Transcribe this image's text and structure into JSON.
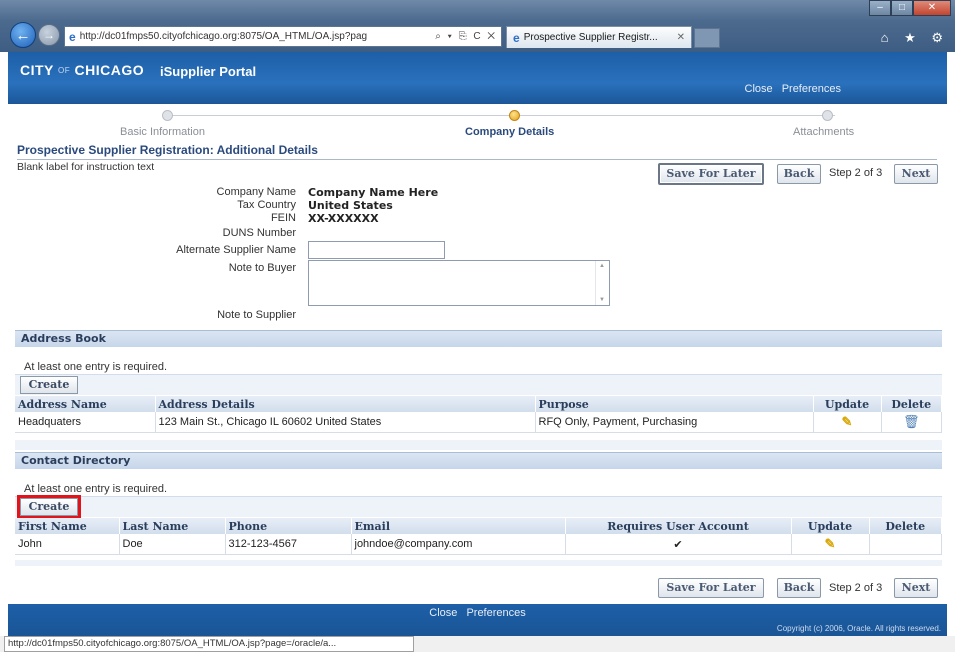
{
  "browser": {
    "url": "http://dc01fmps50.cityofchicago.org:8075/OA_HTML/OA.jsp?pag",
    "url_tools": "⌕ ▾ ⎘ C ✕",
    "tab_title": "Prospective Supplier Registr...",
    "tab_close": "✕",
    "window_min": "–",
    "window_max": "□",
    "window_close": "✕",
    "right_icons": "⌂ ★ ⚙",
    "status_url": "http://dc01fmps50.cityofchicago.org:8075/OA_HTML/OA.jsp?page=/oracle/a..."
  },
  "header": {
    "brand_city": "CITY",
    "brand_of": "OF",
    "brand_chicago": "CHICAGO",
    "portal_title": "iSupplier Portal",
    "close_label": "Close",
    "preferences_label": "Preferences"
  },
  "train": {
    "steps": [
      {
        "label": "Basic Information",
        "active": false
      },
      {
        "label": "Company Details",
        "active": true
      },
      {
        "label": "Attachments",
        "active": false
      }
    ]
  },
  "page": {
    "heading": "Prospective Supplier Registration: Additional Details",
    "instruction": "Blank label for instruction text",
    "save_for_later": "Save For Later",
    "back": "Back",
    "next": "Next",
    "step_text": "Step 2 of 3"
  },
  "form": {
    "company_name_label": "Company Name",
    "company_name_value": "Company Name Here",
    "tax_country_label": "Tax Country",
    "tax_country_value": "United States",
    "fein_label": "FEIN",
    "fein_value": "XX-XXXXXX",
    "duns_label": "DUNS Number",
    "alt_supplier_label": "Alternate Supplier Name",
    "alt_supplier_value": "",
    "note_buyer_label": "Note to Buyer",
    "note_buyer_value": "",
    "note_supplier_label": "Note to Supplier"
  },
  "address_book": {
    "title": "Address Book",
    "note": "At least one entry is required.",
    "create_label": "Create",
    "columns": [
      "Address Name",
      "Address Details",
      "Purpose",
      "Update",
      "Delete"
    ],
    "rows": [
      {
        "name": "Headquaters",
        "details": "123 Main St., Chicago IL 60602 United States",
        "purpose": "RFQ Only, Payment, Purchasing"
      }
    ]
  },
  "contacts": {
    "title": "Contact Directory",
    "note": "At least one entry is required.",
    "create_label": "Create",
    "columns": [
      "First Name",
      "Last Name",
      "Phone",
      "Email",
      "Requires User Account",
      "Update",
      "Delete"
    ],
    "rows": [
      {
        "first": "John",
        "last": "Doe",
        "phone": "312-123-4567",
        "email": "johndoe@company.com",
        "requires_account": "✔"
      }
    ]
  },
  "footer": {
    "close_label": "Close",
    "preferences_label": "Preferences",
    "copyright": "Copyright (c) 2006, Oracle. All rights reserved."
  },
  "colors": {
    "header_blue": "#1d5fa7",
    "section_blue": "#c6d6ea",
    "highlight_red": "#e0141b",
    "active_step": "#e2a21c"
  }
}
